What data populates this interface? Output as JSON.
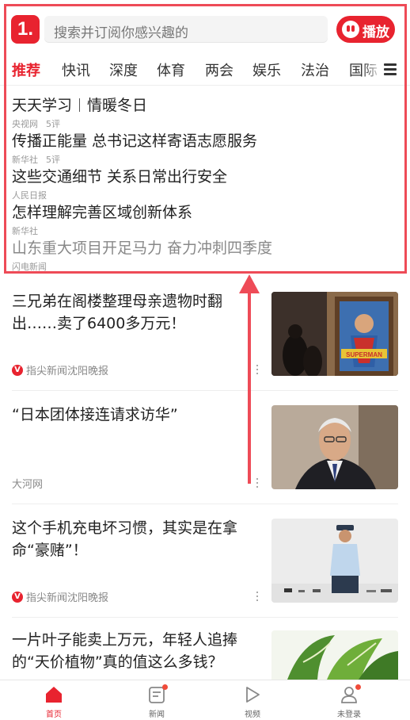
{
  "header": {
    "logo_text": "1.",
    "search_placeholder": "搜索并订阅你感兴趣的",
    "play_label": "播放"
  },
  "tabs": [
    "推荐",
    "快讯",
    "深度",
    "体育",
    "两会",
    "娱乐",
    "法治",
    "国际"
  ],
  "active_tab": "推荐",
  "headlines": [
    {
      "title_a": "天天学习",
      "title_b": "情暖冬日",
      "source": "央视网",
      "comments": "5评"
    },
    {
      "title": "传播正能量 总书记这样寄语志愿服务",
      "source": "新华社",
      "comments": "5评"
    },
    {
      "title": "这些交通细节 关系日常出行安全",
      "source": "人民日报"
    },
    {
      "title": "怎样理解完善区域创新体系",
      "source": "新华社"
    },
    {
      "title": "山东重大项目开足马力 奋力冲刺四季度",
      "source": "闪电新闻"
    }
  ],
  "feed": [
    {
      "title": "三兄弟在阁楼整理母亲遗物时翻出……卖了6400多万元！",
      "source": "指尖新闻沈阳晚报",
      "badge": "V",
      "thumb_caption": "SUPERMAN"
    },
    {
      "title": "“日本团体接连请求访华”",
      "source": "大河网"
    },
    {
      "title": "这个手机充电坏习惯，其实是在拿命“豪赌”！",
      "source": "指尖新闻沈阳晚报",
      "badge": "V"
    },
    {
      "title": "一片叶子能卖上万元，年轻人追捧的“天价植物”真的值这么多钱？",
      "source": ""
    }
  ],
  "nav": [
    {
      "label": "首页",
      "icon": "home-icon",
      "active": true
    },
    {
      "label": "新闻",
      "icon": "news-icon",
      "dot": true
    },
    {
      "label": "视频",
      "icon": "video-icon"
    },
    {
      "label": "未登录",
      "icon": "user-icon",
      "dot": true
    }
  ],
  "colors": {
    "accent": "#e8232f",
    "annotation": "#ee4b57"
  }
}
